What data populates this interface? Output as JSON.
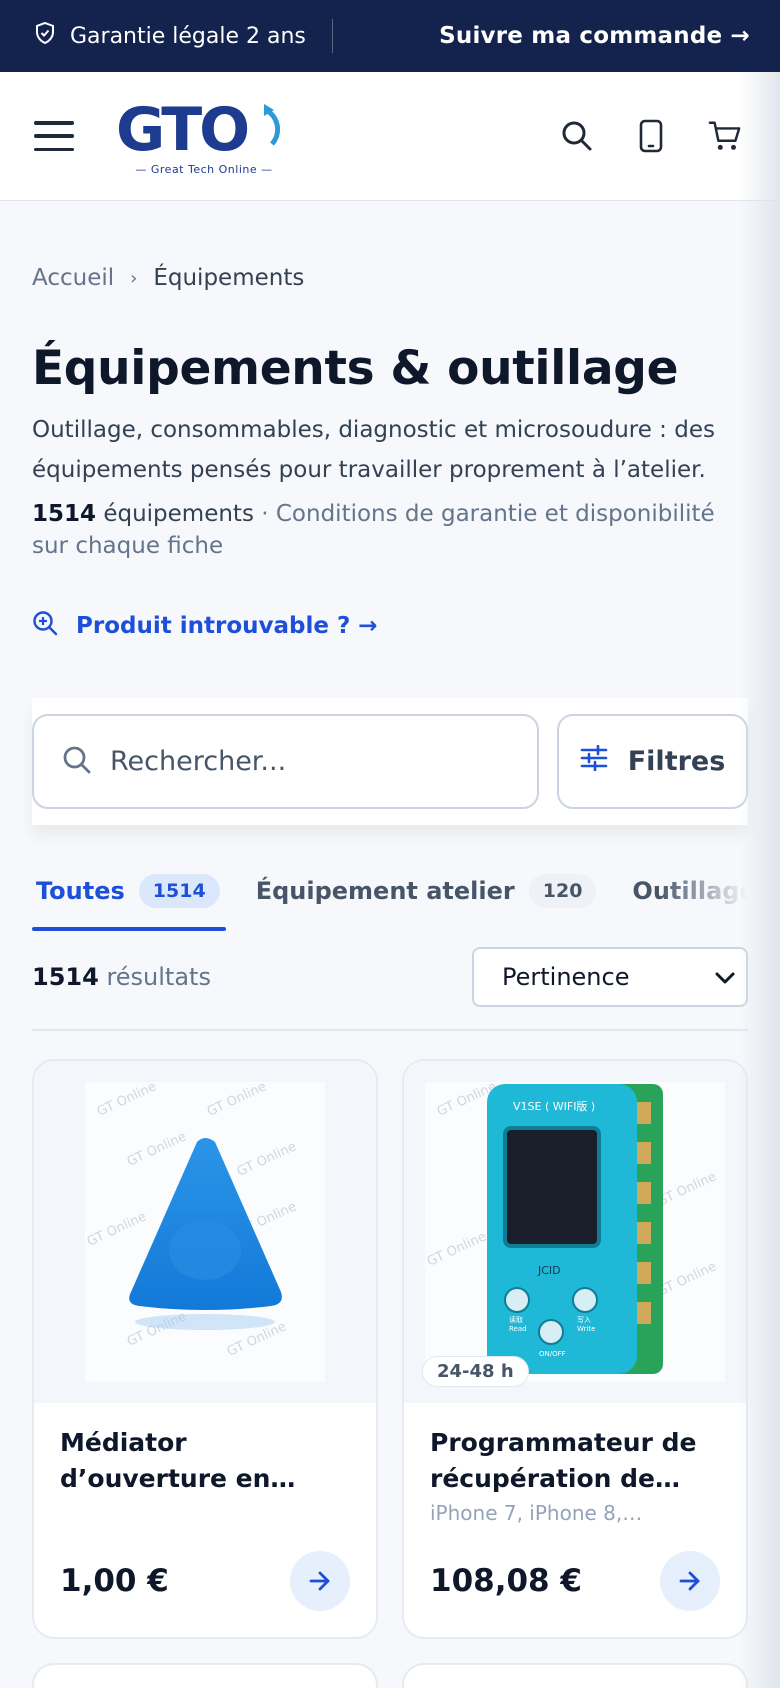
{
  "topbar": {
    "guarantee": "Garantie légale 2 ans",
    "track_order": "Suivre ma commande →"
  },
  "header": {
    "logo_text": "GTO",
    "logo_tagline": "— Great Tech Online —",
    "icons": [
      "menu-icon",
      "search-icon",
      "phone-icon",
      "cart-icon"
    ]
  },
  "breadcrumb": {
    "home": "Accueil",
    "separator": "›",
    "current": "Équipements"
  },
  "page": {
    "title": "Équipements & outillage",
    "lead": "Outillage, consommables, diagnostic et microsoudure : des équipements pensés pour travailler proprement à l’atelier.",
    "count": "1514",
    "count_label": "équipements",
    "count_suffix": " · Conditions de garantie et disponibilité sur chaque fiche",
    "not_found": "Produit introuvable ?  →"
  },
  "search": {
    "placeholder": "Rechercher...",
    "filters_label": "Filtres"
  },
  "tabs": [
    {
      "label": "Toutes",
      "count": "1514",
      "active": true
    },
    {
      "label": "Équipement atelier",
      "count": "120",
      "active": false
    },
    {
      "label": "Outillage",
      "count": "",
      "active": false
    }
  ],
  "results": {
    "count": "1514",
    "label": "résultats",
    "sort_value": "Pertinence"
  },
  "products": [
    {
      "name": "Médiator d’ouverture en…",
      "compat": "",
      "price": "1,00 €",
      "delivery": "",
      "watermark": "GT Online"
    },
    {
      "name": "Programmateur de récupération de…",
      "compat": "iPhone 7, iPhone 8,…",
      "price": "108,08 €",
      "delivery": "24-48 h",
      "watermark": "GT Online",
      "device_labels": {
        "model": "V1SE ( WIFI版 )",
        "brand": "JCID",
        "read_cn": "读取",
        "read": "Read",
        "write_cn": "写入",
        "write": "Write",
        "power": "ON/OFF"
      }
    }
  ],
  "colors": {
    "topbar": "#14224e",
    "accent": "#1d4fd8",
    "logo": "#1d3c8f",
    "logo_arrow": "#2d9ad8"
  }
}
